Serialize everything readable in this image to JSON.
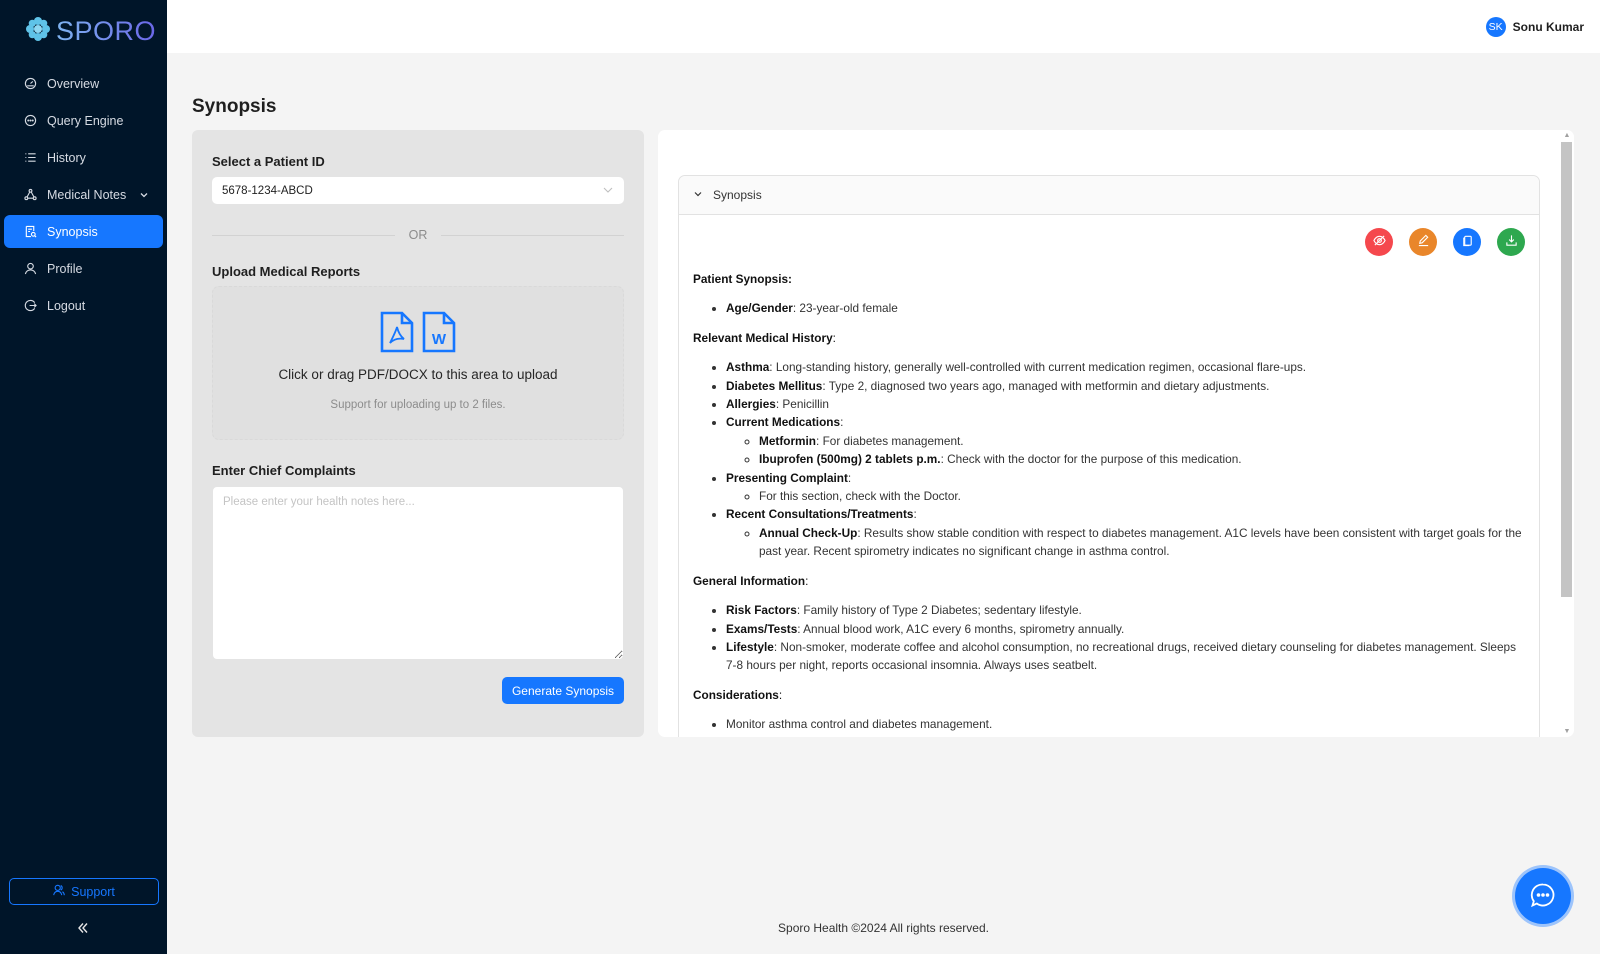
{
  "brand": {
    "name": "SPORO"
  },
  "sidebar": {
    "items": [
      {
        "label": "Overview",
        "icon": "dashboard-icon",
        "active": false
      },
      {
        "label": "Query Engine",
        "icon": "message-icon",
        "active": false
      },
      {
        "label": "History",
        "icon": "list-icon",
        "active": false
      },
      {
        "label": "Medical Notes",
        "icon": "nodes-icon",
        "active": false,
        "has_submenu": true
      },
      {
        "label": "Synopsis",
        "icon": "file-search-icon",
        "active": true
      },
      {
        "label": "Profile",
        "icon": "user-icon",
        "active": false
      },
      {
        "label": "Logout",
        "icon": "logout-icon",
        "active": false
      }
    ],
    "support_label": "Support",
    "collapse_icon": "double-chevron-left-icon"
  },
  "header": {
    "user_initials": "SK",
    "user_name": "Sonu Kumar"
  },
  "page": {
    "title": "Synopsis"
  },
  "form": {
    "patient_label": "Select a Patient ID",
    "patient_value": "5678-1234-ABCD",
    "or_text": "OR",
    "upload_label": "Upload Medical Reports",
    "upload_text": "Click or drag PDF/DOCX to this area to upload",
    "upload_hint": "Support for uploading up to 2 files.",
    "complaints_label": "Enter Chief Complaints",
    "complaints_placeholder": "Please enter your health notes here...",
    "complaints_value": "",
    "generate_label": "Generate Synopsis"
  },
  "synopsis": {
    "panel_title": "Synopsis",
    "actions": [
      {
        "name": "hide",
        "icon": "eye-off-icon",
        "color": "#f5484d"
      },
      {
        "name": "edit",
        "icon": "edit-icon",
        "color": "#e9862a"
      },
      {
        "name": "copy",
        "icon": "copy-icon",
        "color": "#1677ff"
      },
      {
        "name": "download",
        "icon": "download-icon",
        "color": "#2ea84f"
      }
    ],
    "patient_heading": "Patient Synopsis:",
    "age_gender_key": "Age/Gender",
    "age_gender_val": ": 23-year-old female",
    "history_heading": "Relevant Medical History",
    "history": {
      "asthma_key": "Asthma",
      "asthma_val": ": Long-standing history, generally well-controlled with current medication regimen, occasional flare-ups.",
      "diabetes_key": "Diabetes Mellitus",
      "diabetes_val": ": Type 2, diagnosed two years ago, managed with metformin and dietary adjustments.",
      "allergies_key": "Allergies",
      "allergies_val": ": Penicillin",
      "meds_key": "Current Medications",
      "meds": [
        {
          "key": "Metformin",
          "val": ": For diabetes management."
        },
        {
          "key": "Ibuprofen (500mg) 2 tablets p.m.",
          "val": ": Check with the doctor for the purpose of this medication."
        }
      ],
      "complaint_key": "Presenting Complaint",
      "complaint_sub": "For this section, check with the Doctor.",
      "consult_key": "Recent Consultations/Treatments",
      "consult_sub_key": "Annual Check-Up",
      "consult_sub_val": ": Results show stable condition with respect to diabetes management. A1C levels have been consistent with target goals for the past year. Recent spirometry indicates no significant change in asthma control."
    },
    "general_heading": "General Information",
    "general": {
      "risk_key": "Risk Factors",
      "risk_val": ": Family history of Type 2 Diabetes; sedentary lifestyle.",
      "exams_key": "Exams/Tests",
      "exams_val": ": Annual blood work, A1C every 6 months, spirometry annually.",
      "lifestyle_key": "Lifestyle",
      "lifestyle_val": ": Non-smoker, moderate coffee and alcohol consumption, no recreational drugs, received dietary counseling for diabetes management. Sleeps 7-8 hours per night, reports occasional insomnia. Always uses seatbelt."
    },
    "considerations_heading": "Considerations",
    "considerations": [
      "Monitor asthma control and diabetes management."
    ]
  },
  "footer": {
    "text": "Sporo Health ©2024 All rights reserved."
  },
  "colors": {
    "primary": "#1677ff",
    "sidebar_bg": "#001529"
  }
}
